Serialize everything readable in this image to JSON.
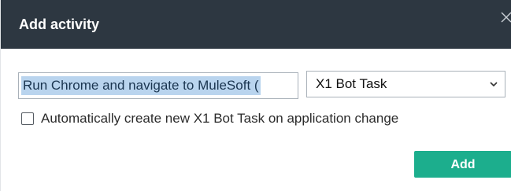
{
  "dialog": {
    "title": "Add activity",
    "close_icon": "close-icon"
  },
  "form": {
    "name_value": "Run Chrome and navigate to MuleSoft (",
    "type_select": {
      "selected": "X1 Bot Task",
      "icon": "chevron-down-icon"
    },
    "auto_create": {
      "checked": false,
      "label": "Automatically create new X1 Bot Task on application change"
    }
  },
  "actions": {
    "add_label": "Add"
  },
  "colors": {
    "header_bg": "#2d3741",
    "header_text": "#ffffff",
    "primary_button": "#1cae8d",
    "selection_highlight": "#b9d4ee"
  }
}
